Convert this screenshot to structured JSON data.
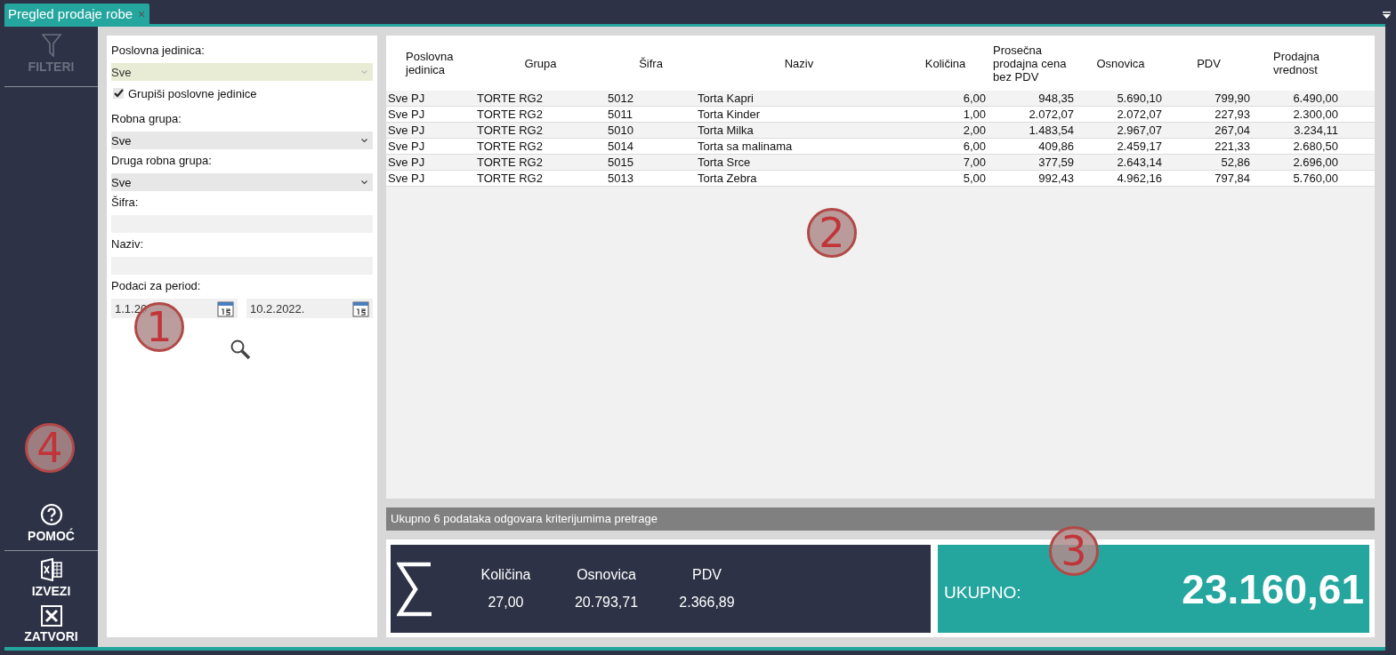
{
  "tab": {
    "title": "Pregled prodaje robe",
    "close": "×",
    "selected": true
  },
  "sidebar": {
    "top": {
      "kind": "filter",
      "label": "FILTERI",
      "disabled": true
    },
    "buttons": [
      {
        "kind": "help",
        "label": "POMOĆ"
      },
      {
        "kind": "export",
        "label": "IZVEZI"
      },
      {
        "kind": "close",
        "label": "ZATVORI"
      }
    ]
  },
  "filters": [
    {
      "kind": "select",
      "label": "Poslovna jedinica:",
      "value": "Sve",
      "disabled": true
    },
    {
      "kind": "checkbox",
      "label": "Grupiši poslovne jedinice",
      "checked": true
    },
    {
      "kind": "select",
      "label": "Robna grupa:",
      "value": "Sve",
      "disabled": false
    },
    {
      "kind": "select",
      "label": "Druga robna grupa:",
      "value": "Sve",
      "disabled": false
    },
    {
      "kind": "text",
      "label": "Šifra:"
    },
    {
      "kind": "text",
      "label": "Naziv:"
    },
    {
      "kind": "daterange",
      "label": "Podaci za period:",
      "from": "1.1.20",
      "to": "10.2.2022."
    }
  ],
  "table": {
    "columns": [
      "Poslovna jedinica",
      "Grupa",
      "Šifra",
      "Naziv",
      "Količina",
      "Prosečna prodajna cena bez PDV",
      "Osnovica",
      "PDV",
      "Prodajna vrednost"
    ],
    "rows": [
      [
        "Sve PJ",
        "TORTE RG2",
        "5012",
        "Torta Kapri",
        "6,00",
        "948,35",
        "5.690,10",
        "799,90",
        "6.490,00"
      ],
      [
        "Sve PJ",
        "TORTE RG2",
        "5011",
        "Torta Kinder",
        "1,00",
        "2.072,07",
        "2.072,07",
        "227,93",
        "2.300,00"
      ],
      [
        "Sve PJ",
        "TORTE RG2",
        "5010",
        "Torta Milka",
        "2,00",
        "1.483,54",
        "2.967,07",
        "267,04",
        "3.234,11"
      ],
      [
        "Sve PJ",
        "TORTE RG2",
        "5014",
        "Torta sa malinama",
        "6,00",
        "409,86",
        "2.459,17",
        "221,33",
        "2.680,50"
      ],
      [
        "Sve PJ",
        "TORTE RG2",
        "5015",
        "Torta Srce",
        "7,00",
        "377,59",
        "2.643,14",
        "52,86",
        "2.696,00"
      ],
      [
        "Sve PJ",
        "TORTE RG2",
        "5013",
        "Torta Zebra",
        "5,00",
        "992,43",
        "4.962,16",
        "797,84",
        "5.760,00"
      ]
    ]
  },
  "status": "Ukupno 6 podataka odgovara kriterijumima pretrage",
  "summary": {
    "items": [
      {
        "label": "Količina",
        "value": "27,00"
      },
      {
        "label": "Osnovica",
        "value": "20.793,71"
      },
      {
        "label": "PDV",
        "value": "2.366,89"
      }
    ],
    "total_label": "UKUPNO:",
    "total_value": "23.160,61"
  },
  "callouts": [
    "1",
    "2",
    "3",
    "4"
  ]
}
